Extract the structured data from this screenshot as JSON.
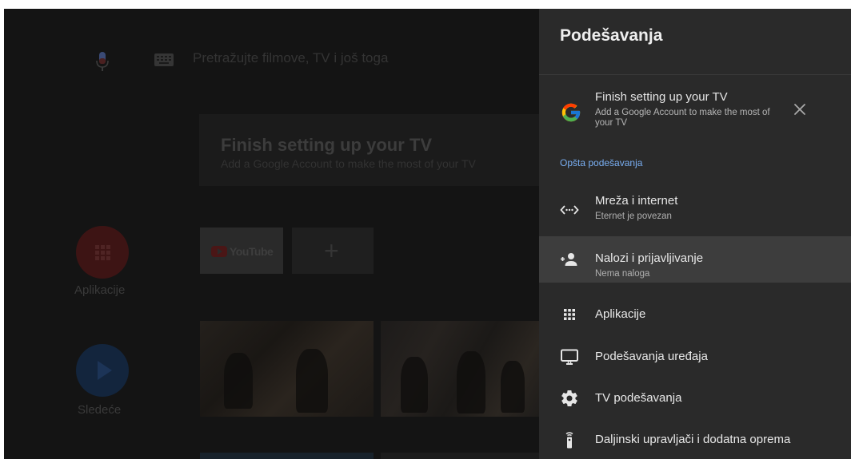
{
  "home": {
    "search_placeholder": "Pretražujte filmove, TV i još toga",
    "promo": {
      "title": "Finish setting up your TV",
      "subtitle": "Add a Google Account to make the most of your TV"
    },
    "sidebar": {
      "apps_label": "Aplikacije",
      "next_label": "Sledeće"
    },
    "channel": {
      "youtube_label": "YouTube"
    }
  },
  "settings": {
    "title": "Podešavanja",
    "setup_card": {
      "title": "Finish setting up your TV",
      "description": "Add a Google Account to make the most of your TV"
    },
    "section_label": "Opšta podešavanja",
    "items": [
      {
        "icon": "network-icon",
        "title": "Mreža i internet",
        "subtitle": "Eternet je povezan"
      },
      {
        "icon": "add-account-icon",
        "title": "Nalozi i prijavljivanje",
        "subtitle": "Nema naloga",
        "selected": true
      },
      {
        "icon": "apps-grid-icon",
        "title": "Aplikacije"
      },
      {
        "icon": "tv-monitor-icon",
        "title": "Podešavanja uređaja"
      },
      {
        "icon": "gear-icon",
        "title": "TV podešavanja"
      },
      {
        "icon": "remote-icon",
        "title": "Daljinski upravljači i dodatna oprema"
      }
    ]
  },
  "colors": {
    "accent": "#79aef1",
    "panel_bg": "#2a2a2a",
    "selected_bg": "#3d3d3d"
  }
}
